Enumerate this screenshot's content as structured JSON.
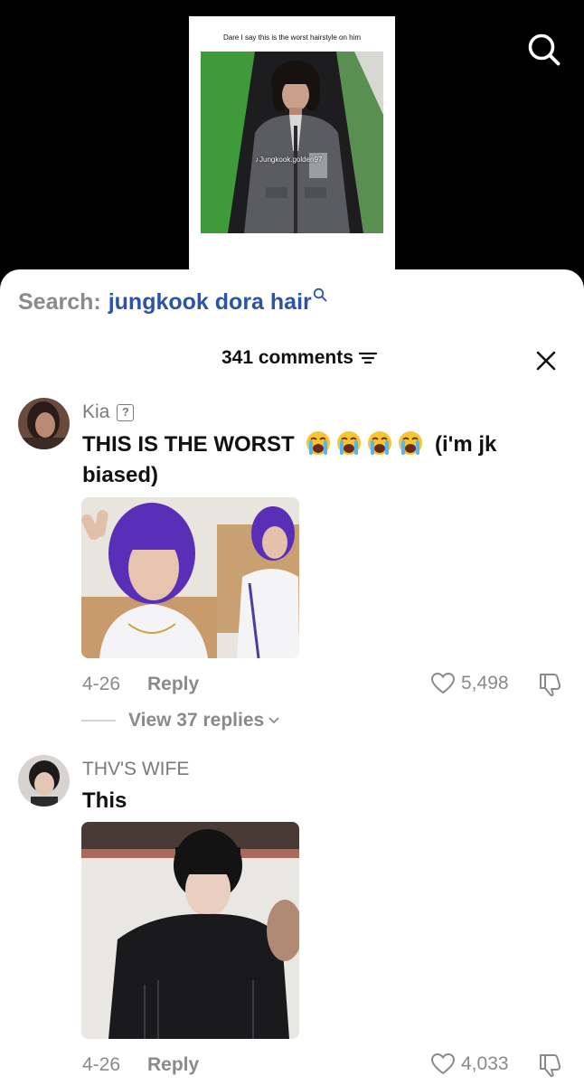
{
  "video": {
    "caption": "Dare I say this is the worst hairstyle on him",
    "watermark": "Jungkook.golden97"
  },
  "search": {
    "prefix": "Search:",
    "query": "jungkook dora hair"
  },
  "comments_header": {
    "count_label": "341 comments"
  },
  "comments": [
    {
      "username": "Kia",
      "text_before": "THIS IS THE WORST",
      "emoji_count": 4,
      "text_after": "(i'm jk biased)",
      "date": "4-26",
      "reply_label": "Reply",
      "likes": "5,498",
      "view_replies": "View 37 replies"
    },
    {
      "username": "THV'S WIFE",
      "text": "This",
      "date": "4-26",
      "reply_label": "Reply",
      "likes": "4,033"
    }
  ],
  "colors": {
    "accent_query": "#2b54a8",
    "muted_text": "#8a8a8a",
    "primary_text": "#111111",
    "background": "#ffffff"
  }
}
